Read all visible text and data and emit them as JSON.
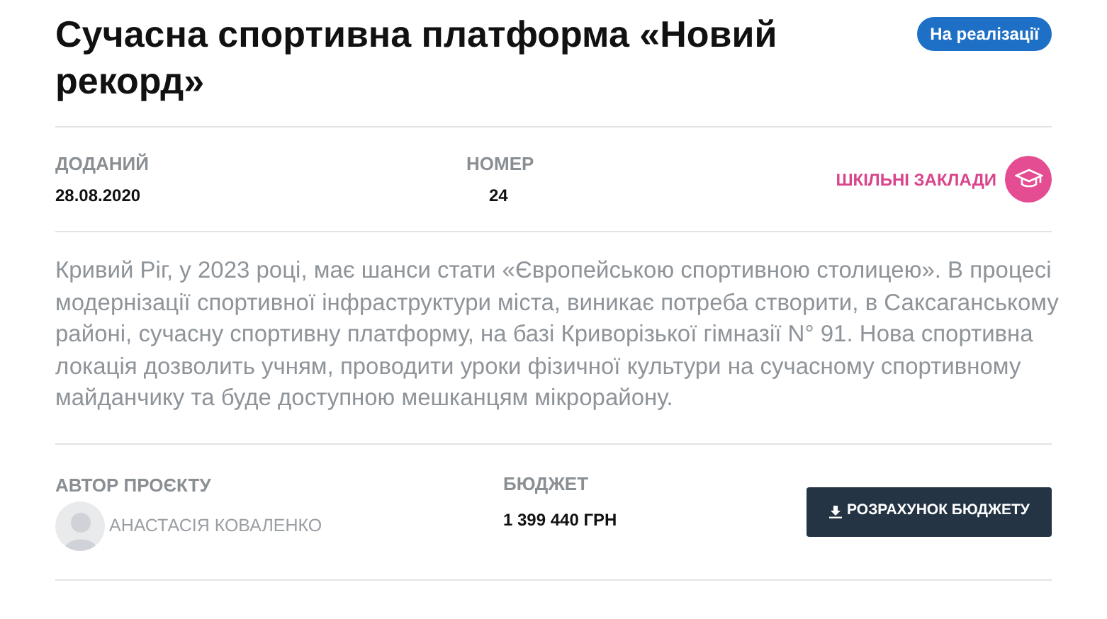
{
  "title": "Сучасна спортивна платформа «Новий рекорд»",
  "status": "На реалізації",
  "meta": [
    {
      "label": "ДОДАНИЙ",
      "value": "28.08.2020"
    },
    {
      "label": "НОМЕР",
      "value": "24"
    }
  ],
  "category": "ШКІЛЬНІ ЗАКЛАДИ",
  "description": "Кривий Ріг, у 2023 році, має шанси стати «Європейською спортивною столицею». В процесі модернізації спортивної інфраструктури міста, виникає потреба створити, в Саксаганському районі, сучасну спортивну платформу, на базі Криворізької гімназії N° 91. Нова спортивна локація дозволить учням, проводити уроки фізичної культури на сучасному спортивному майданчику та буде доступною мешканцям мікрорайону.",
  "author": {
    "label": "АВТОР ПРОЄКТУ",
    "name": "АНАСТАСІЯ КОВАЛЕНКО"
  },
  "budget": {
    "label": "БЮДЖЕТ",
    "value": "1 399 440 ГРН"
  },
  "budget_button": "РОЗРАХУНОК БЮДЖЕТУ"
}
